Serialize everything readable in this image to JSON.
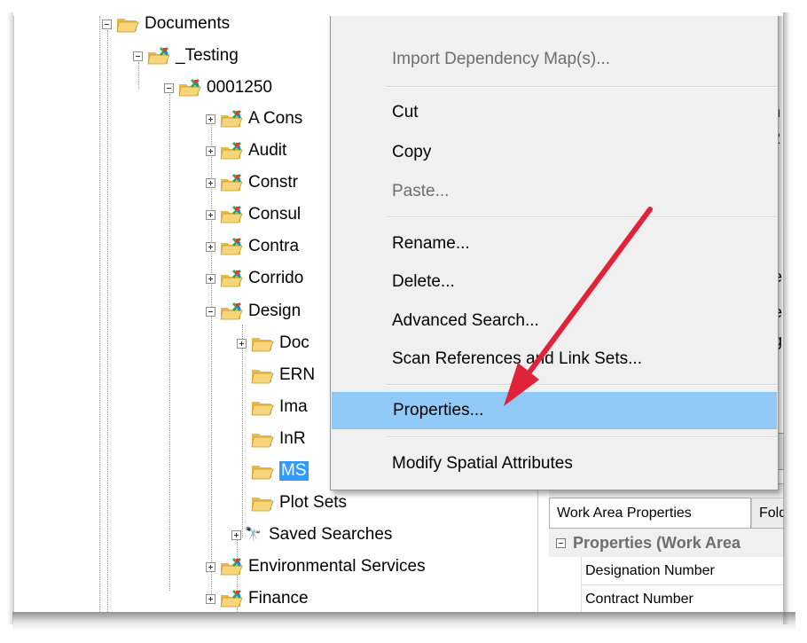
{
  "tree": {
    "nodes": [
      {
        "label": "Documents"
      },
      {
        "label": "_Testing"
      },
      {
        "label": "0001250"
      },
      {
        "label": "A Cons"
      },
      {
        "label": "Audit"
      },
      {
        "label": "Constr"
      },
      {
        "label": "Consul"
      },
      {
        "label": "Contra"
      },
      {
        "label": "Corrido"
      },
      {
        "label": "Design"
      },
      {
        "label": "Doc"
      },
      {
        "label": "ERN"
      },
      {
        "label": "Ima"
      },
      {
        "label": "InR"
      },
      {
        "label": "MS"
      },
      {
        "label": "Plot Sets"
      },
      {
        "label": "Saved Searches"
      },
      {
        "label": "Environmental Services"
      },
      {
        "label": "Finance"
      }
    ]
  },
  "context_menu": {
    "items": [
      {
        "label": "Import Dependency Map(s)..."
      },
      {
        "label": "Cut"
      },
      {
        "label": "Copy"
      },
      {
        "label": "Paste..."
      },
      {
        "label": "Rename..."
      },
      {
        "label": "Delete..."
      },
      {
        "label": "Advanced Search..."
      },
      {
        "label": "Scan References and Link Sets..."
      },
      {
        "label": "Properties..."
      },
      {
        "label": "Modify Spatial Attributes"
      }
    ]
  },
  "properties_panel": {
    "tabs": [
      {
        "label": "Work Area Properties"
      },
      {
        "label": "Fold"
      }
    ],
    "category": "Properties (Work Area",
    "rows": [
      {
        "label": "Designation Number"
      },
      {
        "label": "Contract Number"
      }
    ],
    "peek_chars": [
      "n",
      "2",
      "e",
      "e",
      "g"
    ]
  },
  "colors": {
    "selection": "#3399ff",
    "menu_highlight": "#91c9f7",
    "arrow": "#e0223a"
  }
}
